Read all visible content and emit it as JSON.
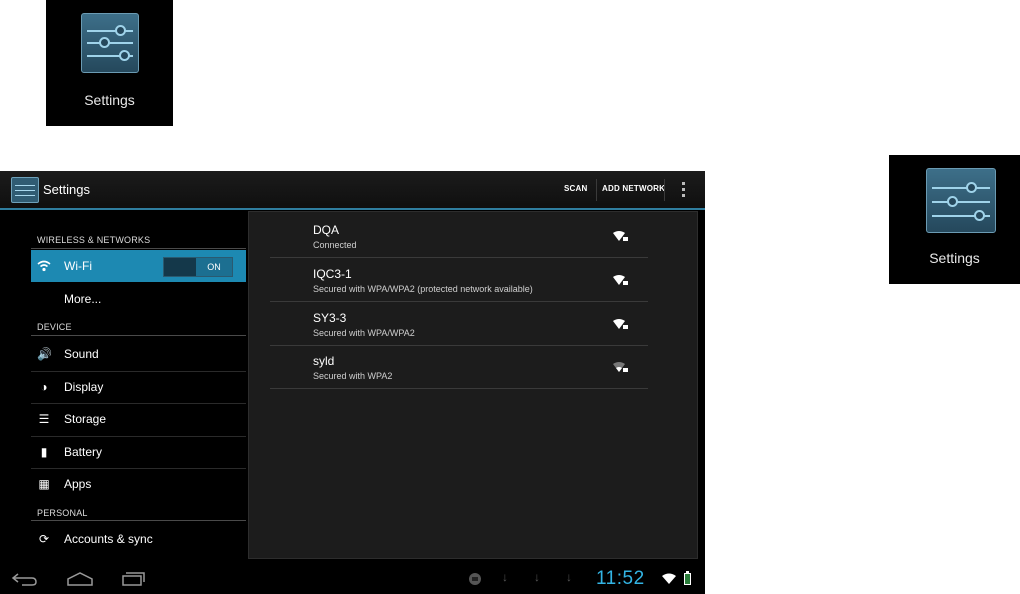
{
  "launcher_top": {
    "label": "Settings",
    "icon": "settings-sliders-icon"
  },
  "launcher_right": {
    "label": "Settings",
    "icon": "settings-sliders-icon"
  },
  "action_bar": {
    "title": "Settings",
    "scan_label": "SCAN",
    "add_network_label": "ADD NETWORK",
    "overflow_icon": "overflow-menu-icon",
    "accent_color": "#33b5e5"
  },
  "left_pane": {
    "wireless_header": "WIRELESS & NETWORKS",
    "wifi": {
      "label": "Wi-Fi",
      "toggle": "ON",
      "icon": "wifi-icon"
    },
    "more": {
      "label": "More..."
    },
    "device_header": "DEVICE",
    "device_items": [
      {
        "label": "Sound",
        "icon": "sound-icon"
      },
      {
        "label": "Display",
        "icon": "display-icon"
      },
      {
        "label": "Storage",
        "icon": "storage-icon"
      },
      {
        "label": "Battery",
        "icon": "battery-icon"
      },
      {
        "label": "Apps",
        "icon": "apps-icon"
      }
    ],
    "personal_header": "PERSONAL",
    "personal_items": [
      {
        "label": "Accounts & sync",
        "icon": "sync-icon"
      }
    ]
  },
  "networks": [
    {
      "name": "DQA",
      "status": "Connected"
    },
    {
      "name": "IQC3-1",
      "status": "Secured with WPA/WPA2 (protected network available)"
    },
    {
      "name": "SY3-3",
      "status": "Secured with WPA/WPA2"
    },
    {
      "name": "syld",
      "status": "Secured with WPA2"
    }
  ],
  "nav_bar": {
    "clock": "11:52"
  }
}
